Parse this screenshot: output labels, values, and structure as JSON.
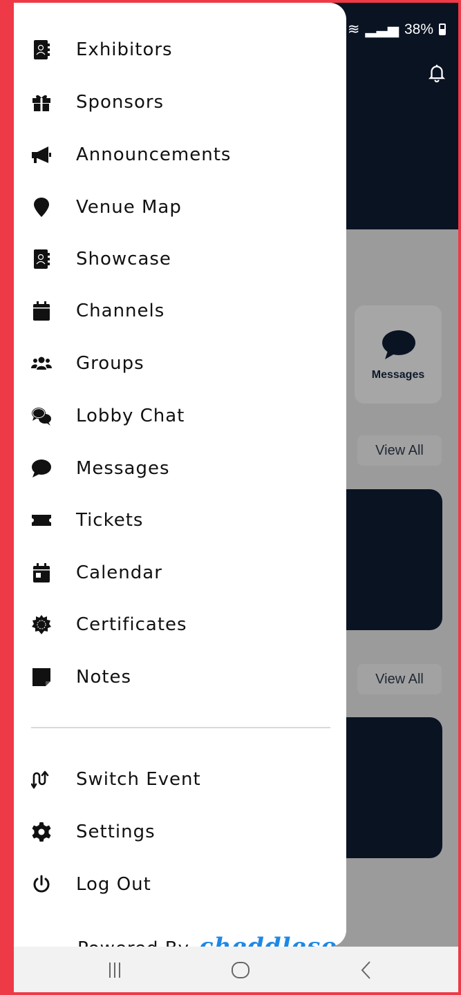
{
  "status_bar": {
    "battery": "38%"
  },
  "background": {
    "messages_label": "Messages",
    "view_all_1": "View All",
    "view_all_2": "View All"
  },
  "menu": {
    "items": [
      {
        "label": "Exhibitors",
        "icon": "address-book-icon"
      },
      {
        "label": "Sponsors",
        "icon": "gift-icon"
      },
      {
        "label": "Announcements",
        "icon": "megaphone-icon"
      },
      {
        "label": "Venue Map",
        "icon": "map-pin-icon"
      },
      {
        "label": "Showcase",
        "icon": "address-book-icon"
      },
      {
        "label": "Channels",
        "icon": "calendar-icon"
      },
      {
        "label": "Groups",
        "icon": "users-icon"
      },
      {
        "label": "Lobby Chat",
        "icon": "comments-icon"
      },
      {
        "label": "Messages",
        "icon": "comment-icon"
      },
      {
        "label": "Tickets",
        "icon": "ticket-icon"
      },
      {
        "label": "Calendar",
        "icon": "calendar-day-icon"
      },
      {
        "label": "Certificates",
        "icon": "certificate-icon"
      },
      {
        "label": "Notes",
        "icon": "sticky-note-icon"
      }
    ],
    "footer_items": [
      {
        "label": "Switch Event",
        "icon": "switch-arrows-icon"
      },
      {
        "label": "Settings",
        "icon": "gear-icon"
      },
      {
        "label": "Log Out",
        "icon": "power-icon"
      }
    ],
    "powered_by": "Powered By",
    "brand": "cheddleso"
  },
  "navbar": {
    "recent": "recent-apps-icon",
    "home": "home-icon",
    "back": "back-icon"
  }
}
